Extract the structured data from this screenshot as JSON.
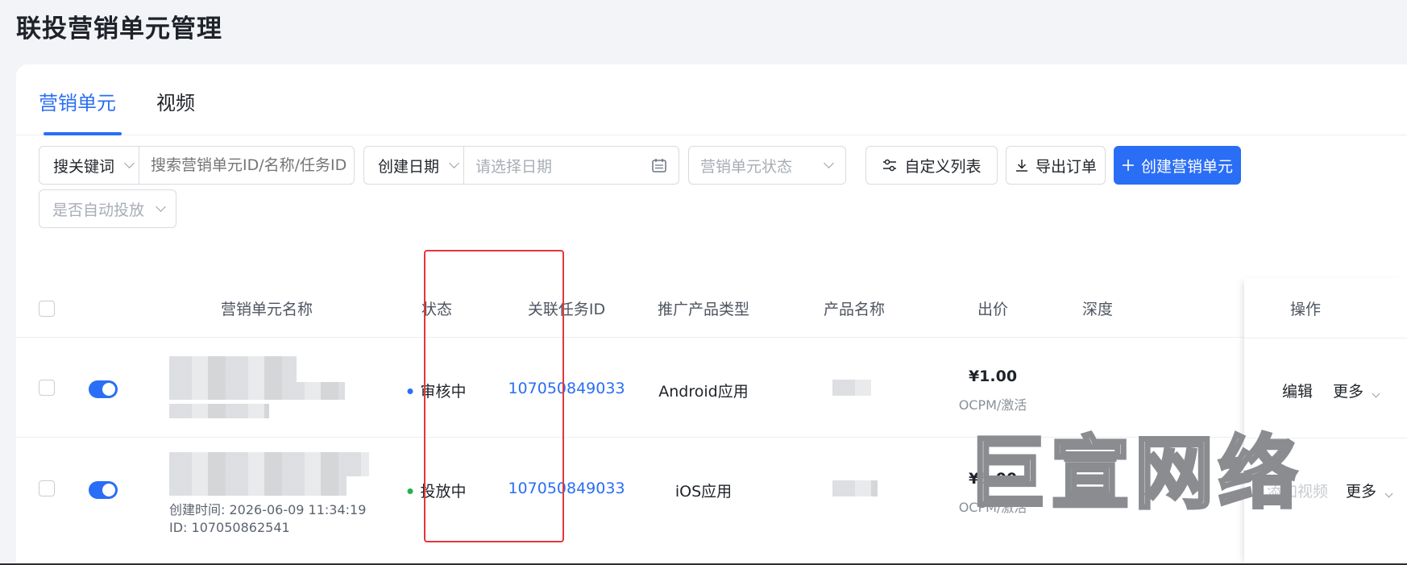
{
  "page": {
    "title": "联投营销单元管理"
  },
  "tabs": [
    {
      "label": "营销单元",
      "active": true
    },
    {
      "label": "视频",
      "active": false
    }
  ],
  "filters": {
    "keyword_select": "搜关键词",
    "keyword_placeholder": "搜索营销单元ID/名称/任务ID",
    "date_select": "创建日期",
    "date_placeholder": "请选择日期",
    "status_placeholder": "营销单元状态",
    "auto_placeholder": "是否自动投放"
  },
  "toolbar": {
    "custom_columns": "自定义列表",
    "export_orders": "导出订单",
    "create_unit": "创建营销单元"
  },
  "table": {
    "headers": {
      "name": "营销单元名称",
      "status": "状态",
      "task_id": "关联任务ID",
      "product_type": "推广产品类型",
      "product_name": "产品名称",
      "bid": "出价",
      "depth": "深度",
      "actions": "操作"
    },
    "rows": [
      {
        "status": "审核中",
        "task_id": "107050849033",
        "product_type": "Android应用",
        "bid": "¥1.00",
        "bid_mode": "OCPM/激活",
        "edit": "编辑",
        "more": "更多",
        "enabled": true
      },
      {
        "status": "投放中",
        "created": "创建时间: 2026-06-09 11:34:19",
        "unit_id": "ID: 107050862541",
        "task_id": "107050849033",
        "product_type": "iOS应用",
        "bid": "¥5.00",
        "bid_mode": "OCPM/激活",
        "add_video": "添加视频",
        "more": "更多",
        "enabled": true
      }
    ]
  },
  "watermark": "巨宣网络",
  "colors": {
    "accent": "#2a6ef5",
    "status_review": "#2a6ef5",
    "status_running": "#27b04a",
    "highlight": "#e5363d"
  }
}
